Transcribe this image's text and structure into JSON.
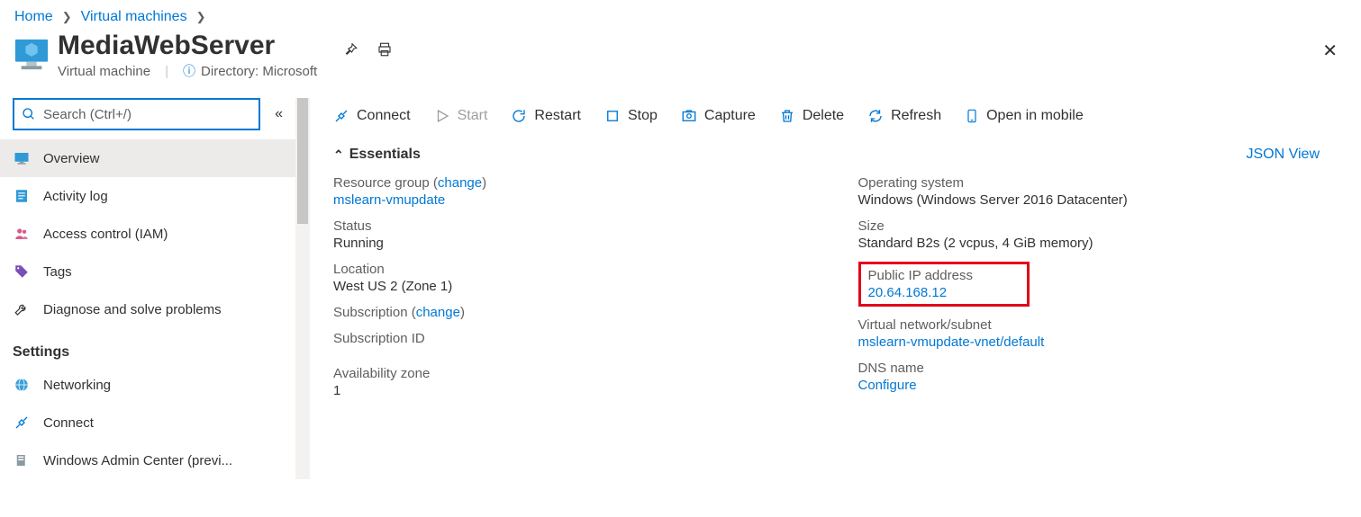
{
  "breadcrumb": {
    "home": "Home",
    "vms": "Virtual machines"
  },
  "header": {
    "title": "MediaWebServer",
    "subtitle": "Virtual machine",
    "directory_label": "Directory: Microsoft"
  },
  "search": {
    "placeholder": "Search (Ctrl+/)"
  },
  "sidebar": {
    "settings_label": "Settings",
    "items": {
      "overview": "Overview",
      "activity": "Activity log",
      "iam": "Access control (IAM)",
      "tags": "Tags",
      "diagnose": "Diagnose and solve problems",
      "networking": "Networking",
      "connect": "Connect",
      "wac": "Windows Admin Center (previ..."
    }
  },
  "toolbar": {
    "connect": "Connect",
    "start": "Start",
    "restart": "Restart",
    "stop": "Stop",
    "capture": "Capture",
    "delete": "Delete",
    "refresh": "Refresh",
    "mobile": "Open in mobile"
  },
  "essentials": {
    "heading": "Essentials",
    "json_view": "JSON View",
    "change": "change",
    "left": {
      "rg_label": "Resource group (",
      "rg_value": "mslearn-vmupdate",
      "status_label": "Status",
      "status_value": "Running",
      "loc_label": "Location",
      "loc_value": "West US 2 (Zone 1)",
      "sub_label": "Subscription (",
      "subid_label": "Subscription ID",
      "az_label": "Availability zone",
      "az_value": "1"
    },
    "right": {
      "os_label": "Operating system",
      "os_value": "Windows (Windows Server 2016 Datacenter)",
      "size_label": "Size",
      "size_value": "Standard B2s (2 vcpus, 4 GiB memory)",
      "pip_label": "Public IP address",
      "pip_value": "20.64.168.12",
      "vnet_label": "Virtual network/subnet",
      "vnet_value": "mslearn-vmupdate-vnet/default",
      "dns_label": "DNS name",
      "dns_value": "Configure"
    }
  }
}
